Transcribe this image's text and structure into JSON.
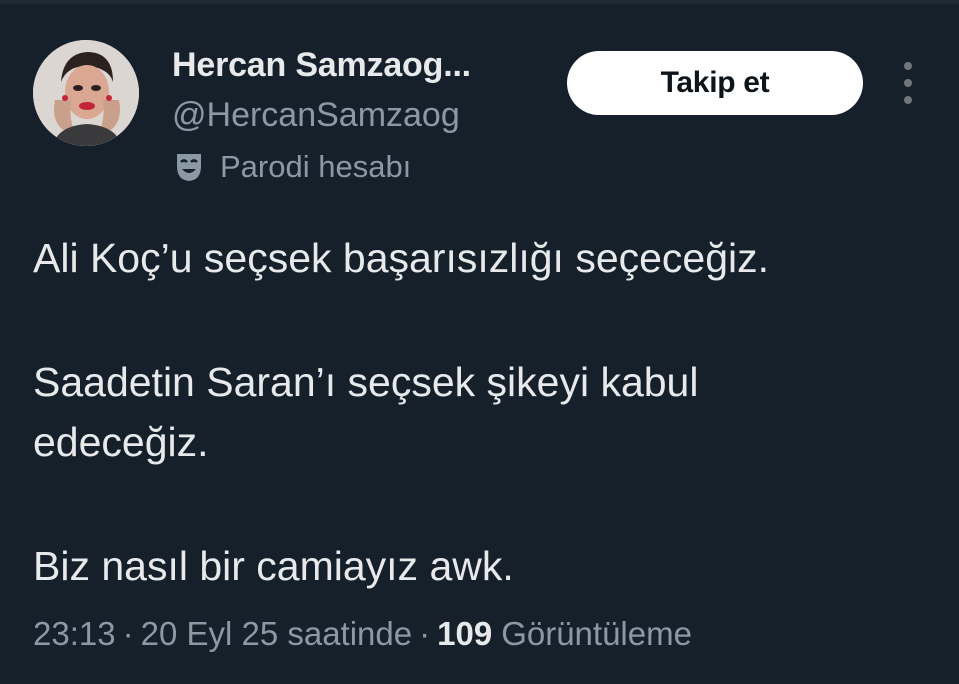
{
  "tweet": {
    "author": {
      "display_name": "Hercan Samzaog...",
      "handle": "@HercanSamzaog",
      "account_label": "Parodi hesabı",
      "account_label_icon": "theater-mask-icon",
      "avatar": "avatar"
    },
    "follow_button_label": "Takip et",
    "more_icon": "more-vertical-icon",
    "text_lines": [
      "Ali Koç’u seçsek başarısızlığı seçeceğiz.",
      "Saadetin Saran’ı seçsek şikeyi kabul",
      "edeceğiz.",
      "Biz nasıl bir camiayız awk."
    ],
    "meta": {
      "time": "23:13",
      "separator": "·",
      "date": "20 Eyl 25 saatinde",
      "views_count": "109",
      "views_label": "Görüntüleme"
    }
  },
  "colors": {
    "background": "#15202b",
    "primary_text": "#e7e9ea",
    "secondary_text": "#8b98a5",
    "button_bg": "#ffffff",
    "button_text": "#0f1419"
  }
}
